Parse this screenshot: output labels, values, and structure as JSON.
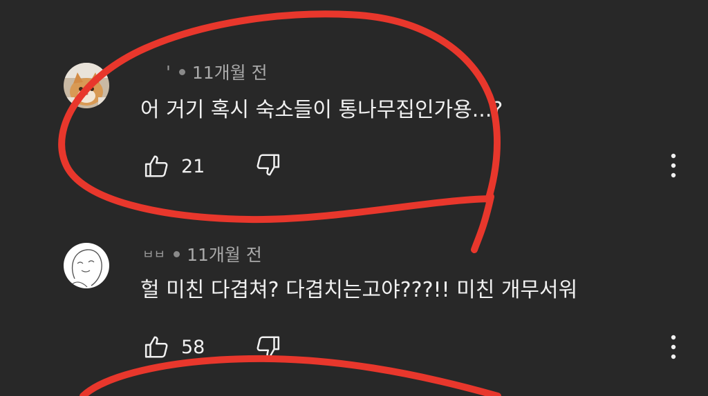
{
  "comments": [
    {
      "author": "'",
      "time": "11개월 전",
      "text": "어 거기 혹시 숙소들이 통나무집인가용...?",
      "likes": "21",
      "avatar_icon": "cat-photo-avatar"
    },
    {
      "author": "ㅂㅂ",
      "time": "11개월 전",
      "text": "헐 미친 다겹쳐? 다겹치는고야???!! 미친 개무서워",
      "likes": "58",
      "avatar_icon": "doodle-face-avatar"
    }
  ],
  "icons": {
    "like": "thumbs-up-icon",
    "dislike": "thumbs-down-icon",
    "more": "more-vertical-icon"
  },
  "colors": {
    "background": "#282828",
    "text": "#f1f1f1",
    "meta": "#aaaaaa",
    "annotation": "#e8372c"
  }
}
